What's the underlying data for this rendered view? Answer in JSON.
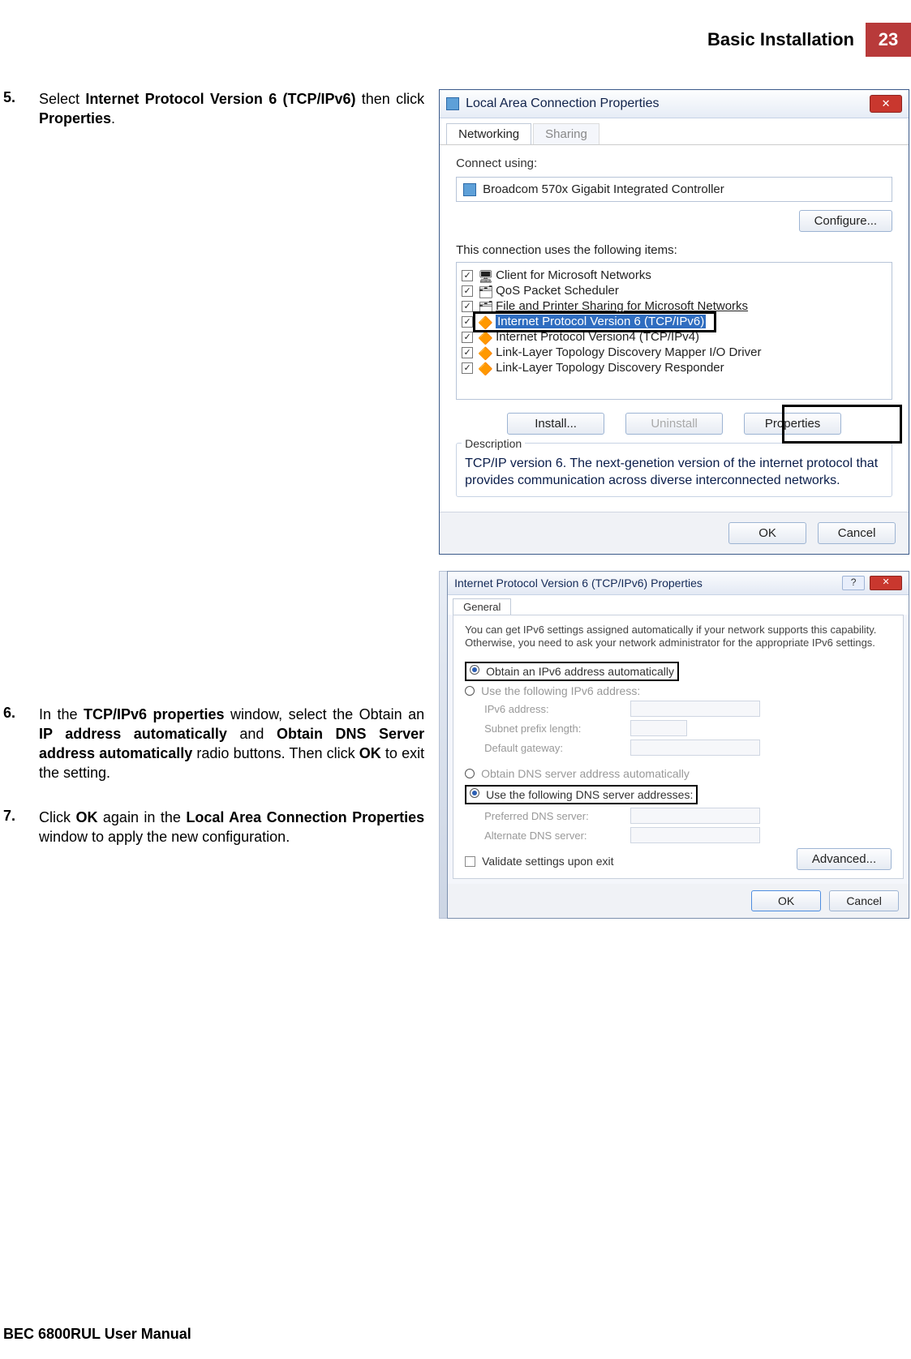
{
  "header": {
    "title": "Basic Installation",
    "page": "23"
  },
  "footer": "BEC 6800RUL User Manual",
  "steps": [
    {
      "num": "5.",
      "parts": [
        "Select ",
        {
          "b": "Internet Protocol Version 6 (TCP/IPv6)"
        },
        " then click ",
        {
          "b": "Properties"
        },
        "."
      ]
    },
    {
      "num": "6.",
      "parts": [
        "In the ",
        {
          "b": "TCP/IPv6 properties"
        },
        " window, select the Obtain an ",
        {
          "b": "IP address automatically"
        },
        " and ",
        {
          "b": "Obtain DNS Server address automatically"
        },
        " radio buttons. Then click ",
        {
          "b": "OK"
        },
        " to exit the setting."
      ]
    },
    {
      "num": "7.",
      "parts": [
        "Click ",
        {
          "b": "OK"
        },
        " again in the ",
        {
          "b": "Local Area Connection Properties"
        },
        " window to apply the new configuration."
      ]
    }
  ],
  "dialog1": {
    "title": "Local Area Connection Properties",
    "tabs": {
      "active": "Networking",
      "inactive": "Sharing"
    },
    "connect_label": "Connect using:",
    "adapter": "Broadcom 570x Gigabit Integrated Controller",
    "configure_btn": "Configure...",
    "items_label": "This connection uses the following items:",
    "items": [
      "Client for Microsoft Networks",
      "QoS Packet Scheduler",
      "File and Printer Sharing for Microsoft Networks",
      "Internet Protocol Version 6 (TCP/IPv6)",
      "Internet Protocol Version4 (TCP/IPv4)",
      "Link-Layer Topology Discovery Mapper I/O Driver",
      "Link-Layer Topology Discovery Responder"
    ],
    "install_btn": "Install...",
    "uninstall_btn": "Uninstall",
    "properties_btn": "Properties",
    "desc_legend": "Description",
    "desc_text": "TCP/IP version 6. The next-genetion version of the internet protocol that provides communication across diverse interconnected networks.",
    "ok": "OK",
    "cancel": "Cancel"
  },
  "dialog2": {
    "title": "Internet Protocol Version 6 (TCP/IPv6) Properties",
    "tab": "General",
    "info": "You can get IPv6 settings assigned automatically if your network supports this capability. Otherwise, you need to ask your network administrator for the appropriate IPv6 settings.",
    "radio_auto_addr": "Obtain an IPv6 address automatically",
    "radio_manual_addr": "Use the following IPv6 address:",
    "lbl_ipv6": "IPv6 address:",
    "lbl_prefix": "Subnet prefix length:",
    "lbl_gateway": "Default gateway:",
    "radio_auto_dns": "Obtain DNS server address automatically",
    "radio_manual_dns": "Use the following DNS server addresses:",
    "lbl_pdns": "Preferred DNS server:",
    "lbl_adns": "Alternate DNS server:",
    "validate": "Validate settings upon exit",
    "advanced": "Advanced...",
    "ok": "OK",
    "cancel": "Cancel"
  }
}
